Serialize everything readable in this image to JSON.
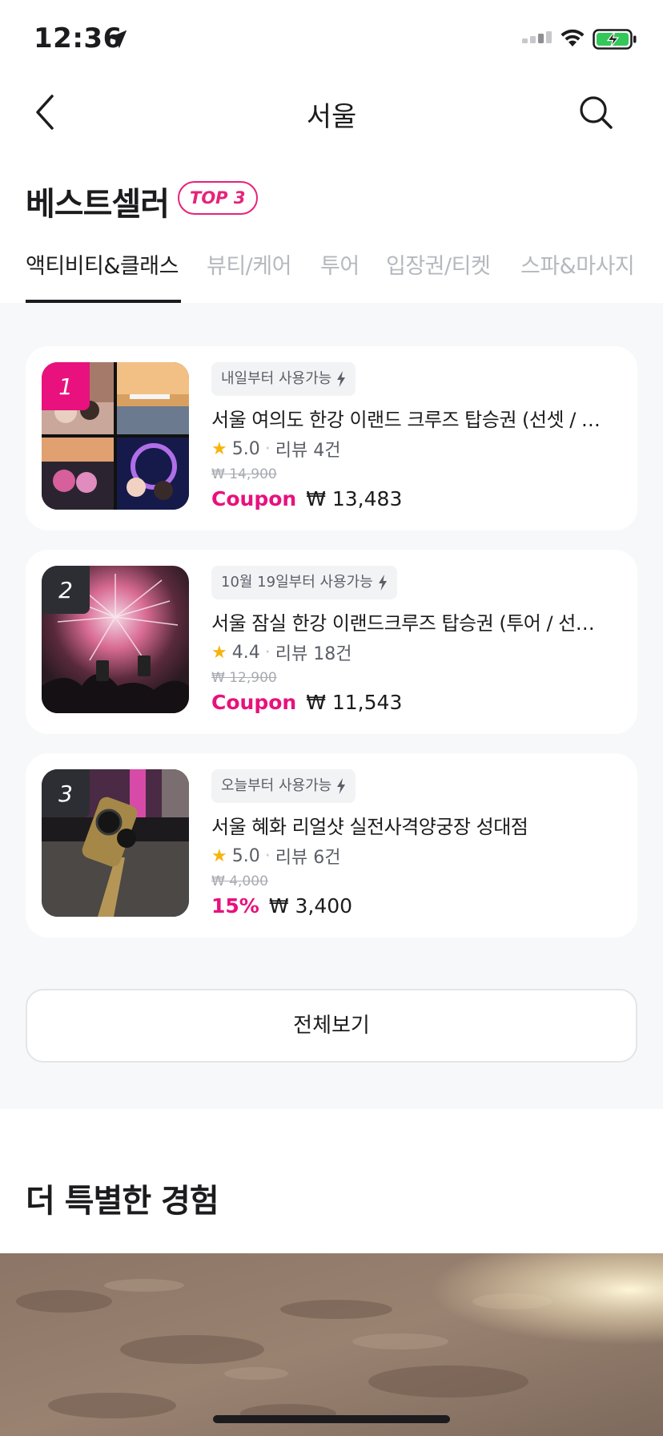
{
  "status": {
    "time": "12:36"
  },
  "nav": {
    "title": "서울"
  },
  "section": {
    "title": "베스트셀러",
    "badge": "TOP 3"
  },
  "tabs": [
    {
      "label": "액티비티&클래스",
      "active": true
    },
    {
      "label": "뷰티/케어",
      "active": false
    },
    {
      "label": "투어",
      "active": false
    },
    {
      "label": "입장권/티켓",
      "active": false
    },
    {
      "label": "스파&마사지",
      "active": false
    }
  ],
  "products": [
    {
      "rank": "1",
      "availability": "내일부터 사용가능",
      "title": "서울 여의도 한강 이랜드 크루즈 탑승권 (선셋 / 야경 / 불꽃)",
      "rating": "5.0",
      "reviews": "리뷰 4건",
      "original_price": "₩ 14,900",
      "discount_label": "Coupon",
      "price": "₩ 13,483"
    },
    {
      "rank": "2",
      "availability": "10월 19일부터 사용가능",
      "title": "서울 잠실 한강 이랜드크루즈 탑승권 (투어 / 선셋 / 야경)",
      "rating": "4.4",
      "reviews": "리뷰 18건",
      "original_price": "₩ 12,900",
      "discount_label": "Coupon",
      "price": "₩ 11,543"
    },
    {
      "rank": "3",
      "availability": "오늘부터 사용가능",
      "title": "서울 혜화 리얼샷 실전사격양궁장 성대점",
      "rating": "5.0",
      "reviews": "리뷰 6건",
      "original_price": "₩ 4,000",
      "discount_label": "15%",
      "price": "₩ 3,400"
    }
  ],
  "view_all": "전체보기",
  "special": {
    "title": "더 특별한 경험"
  },
  "colors": {
    "accent": "#e8117d",
    "star": "#f6b40e",
    "text": "#1c1c1e",
    "muted": "#b5b8be"
  }
}
